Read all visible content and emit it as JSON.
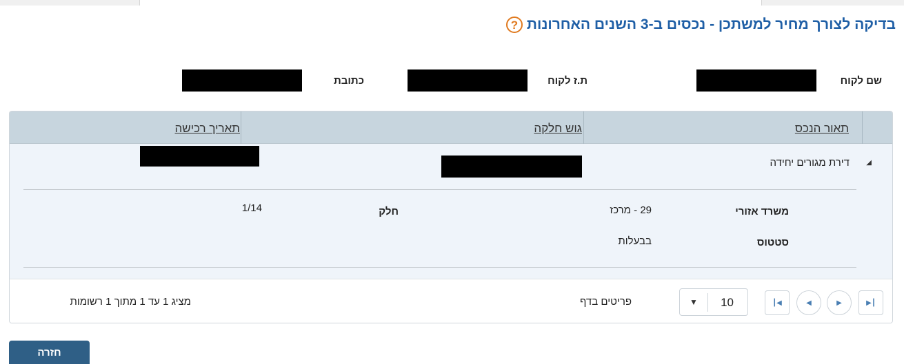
{
  "title": "בדיקה לצורך מחיר למשתכן - נכסים ב-3 השנים האחרונות",
  "icons": {
    "help": "question-mark-circle-icon",
    "expand": "triangle-expanded-icon"
  },
  "help_glyph": "?",
  "customer": {
    "name_label": "שם לקוח",
    "id_label": "ת.ז לקוח",
    "address_label": "כתובת"
  },
  "grid": {
    "columns": [
      "תאור הנכס",
      "גוש חלקה",
      "תאריך רכישה"
    ],
    "rows": [
      {
        "asset_description": "דירת מגורים יחידה",
        "details": {
          "office_label": "משרד אזורי",
          "office_value": "29 - מרכז",
          "part_label": "חלק",
          "part_value": "1/14",
          "status_label": "סטטוס",
          "status_value": "בבעלות"
        }
      }
    ]
  },
  "pager": {
    "page_size": "10",
    "page_size_label": "פריטים בדף",
    "summary": "מציג 1 עד 1 מתוך 1 רשומות"
  },
  "back_button": "חזרה",
  "colors": {
    "title": "#1f5fa6",
    "help": "#e07a1f",
    "header": "#c7d5de",
    "row": "#eff4fa",
    "button": "#2f5f86"
  }
}
